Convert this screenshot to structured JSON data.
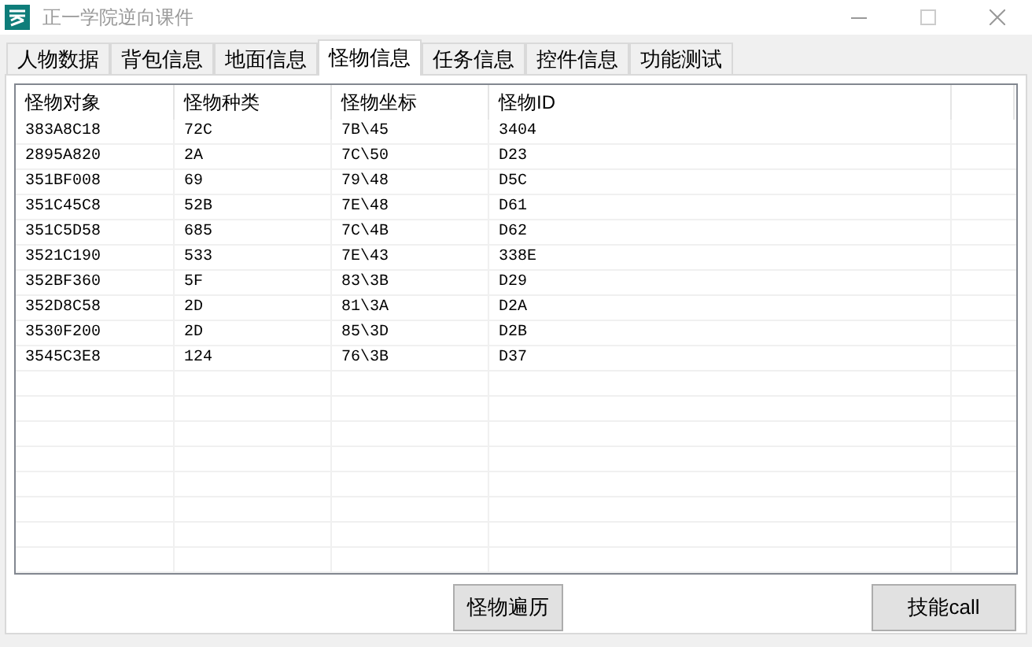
{
  "window": {
    "title": "正一学院逆向课件"
  },
  "tabs": [
    {
      "label": "人物数据",
      "selected": false
    },
    {
      "label": "背包信息",
      "selected": false
    },
    {
      "label": "地面信息",
      "selected": false
    },
    {
      "label": "怪物信息",
      "selected": true
    },
    {
      "label": "任务信息",
      "selected": false
    },
    {
      "label": "控件信息",
      "selected": false
    },
    {
      "label": "功能测试",
      "selected": false
    }
  ],
  "table": {
    "columns": [
      "怪物对象",
      "怪物种类",
      "怪物坐标",
      "怪物ID"
    ],
    "rows": [
      [
        "383A8C18",
        "72C",
        "7B\\45",
        "3404"
      ],
      [
        "2895A820",
        "2A",
        "7C\\50",
        "D23"
      ],
      [
        "351BF008",
        "69",
        "79\\48",
        "D5C"
      ],
      [
        "351C45C8",
        "52B",
        "7E\\48",
        "D61"
      ],
      [
        "351C5D58",
        "685",
        "7C\\4B",
        "D62"
      ],
      [
        "3521C190",
        "533",
        "7E\\43",
        "338E"
      ],
      [
        "352BF360",
        "5F",
        "83\\3B",
        "D29"
      ],
      [
        "352D8C58",
        "2D",
        "81\\3A",
        "D2A"
      ],
      [
        "3530F200",
        "2D",
        "85\\3D",
        "D2B"
      ],
      [
        "3545C3E8",
        "124",
        "76\\3B",
        "D37"
      ]
    ]
  },
  "buttons": [
    "怪物遍历",
    "技能call"
  ]
}
